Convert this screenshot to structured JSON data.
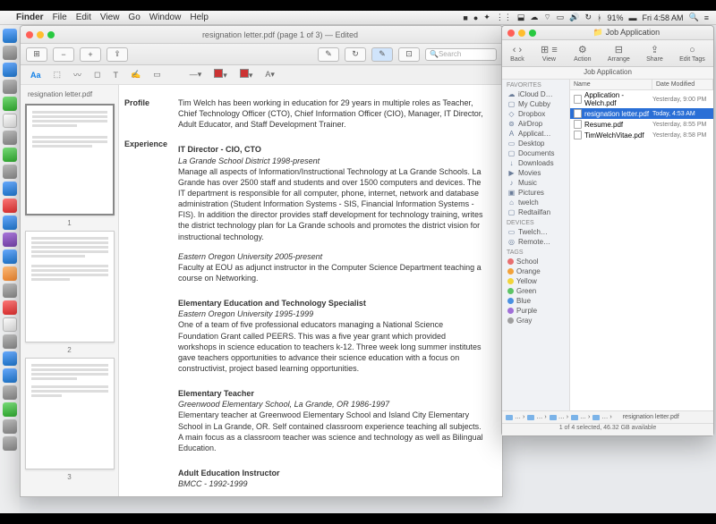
{
  "menubar": {
    "app": "Finder",
    "items": [
      "File",
      "Edit",
      "View",
      "Go",
      "Window",
      "Help"
    ],
    "battery": "91%",
    "clock": "Fri 4:58 AM"
  },
  "preview": {
    "title": "resignation letter.pdf (page 1 of 3) — Edited",
    "search_ph": "Search",
    "sidebar_title": "resignation letter.pdf",
    "markup": {
      "aa": "Aa"
    },
    "thumbs": [
      "1",
      "2",
      "3"
    ],
    "profile_label": "Profile",
    "experience_label": "Experience",
    "profile_text": "Tim Welch has been working in education for 29 years in multiple roles as Teacher, Chief Technology Officer (CTO), Chief Information Officer (CIO), Manager, IT Director, Adult Educator, and Staff Development Trainer.",
    "jobs": [
      {
        "title": "IT Director - CIO, CTO",
        "sub": "La Grande School District        1998-present",
        "desc": "Manage all aspects of Information/Instructional Technology at La Grande Schools. La Grande has over 2500 staff and students and over 1500 computers and devices. The IT department is responsible for all computer, phone, internet, network and database administration (Student Information Systems - SIS, Financial Information Systems - FIS). In addition the director provides staff development for technology training, writes the district technology plan for La Grande schools and promotes the district vision for instructional technology."
      },
      {
        "title": "",
        "sub": "Eastern Oregon University        2005-present",
        "desc": "Faculty at EOU as adjunct instructor in the Computer Science Department teaching a course on Networking."
      },
      {
        "title": "Elementary Education and Technology Specialist",
        "sub": "Eastern Oregon University        1995-1999",
        "desc": "One of a team of five professional educators managing a National Science Foundation Grant called PEERS. This was a five year grant which provided workshops in science education to teachers k-12. Three week long summer institutes gave teachers opportunities to advance their science education with a focus on constructivist, project based learning opportunities."
      },
      {
        "title": "Elementary Teacher",
        "sub": "Greenwood Elementary School, La Grande, OR    1986-1997",
        "desc": "Elementary teacher at Greenwood Elementary School and Island City Elementary School in La Grande, OR. Self contained classroom experience teaching all subjects. A main focus as a classroom teacher was science and technology as well as Bilingual Education."
      },
      {
        "title": "Adult Education Instructor",
        "sub": "BMCC - 1992-1999",
        "desc": ""
      }
    ]
  },
  "finder": {
    "title": "Job Application",
    "path": "Job Application",
    "toolbar": {
      "back": "Back",
      "view": "View",
      "action": "Action",
      "arrange": "Arrange",
      "share": "Share",
      "edit": "Edit Tags"
    },
    "cols": {
      "name": "Name",
      "date": "Date Modified"
    },
    "files": [
      {
        "name": "Application - Welch.pdf",
        "date": "Yesterday, 9:00 PM",
        "sel": false
      },
      {
        "name": "resignation letter.pdf",
        "date": "Today, 4:53 AM",
        "sel": true
      },
      {
        "name": "Resume.pdf",
        "date": "Yesterday, 8:55 PM",
        "sel": false
      },
      {
        "name": "TimWelchVitae.pdf",
        "date": "Yesterday, 8:58 PM",
        "sel": false
      }
    ],
    "favorites_h": "Favorites",
    "favorites": [
      {
        "icon": "☁",
        "label": "iCloud D…"
      },
      {
        "icon": "▢",
        "label": "My Cubby"
      },
      {
        "icon": "◇",
        "label": "Dropbox"
      },
      {
        "icon": "⊚",
        "label": "AirDrop"
      },
      {
        "icon": "A",
        "label": "Applicat…"
      },
      {
        "icon": "▭",
        "label": "Desktop"
      },
      {
        "icon": "▢",
        "label": "Documents"
      },
      {
        "icon": "↓",
        "label": "Downloads"
      },
      {
        "icon": "▶",
        "label": "Movies"
      },
      {
        "icon": "♪",
        "label": "Music"
      },
      {
        "icon": "▣",
        "label": "Pictures"
      },
      {
        "icon": "⌂",
        "label": "twelch"
      },
      {
        "icon": "▢",
        "label": "Redtailfan"
      }
    ],
    "devices_h": "Devices",
    "devices": [
      {
        "icon": "▭",
        "label": "Twelch…"
      },
      {
        "icon": "◎",
        "label": "Remote…"
      }
    ],
    "tags_h": "Tags",
    "tags": [
      {
        "color": "#e86f6f",
        "label": "School"
      },
      {
        "color": "#f2a23a",
        "label": "Orange"
      },
      {
        "color": "#f2d43a",
        "label": "Yellow"
      },
      {
        "color": "#5dc466",
        "label": "Green"
      },
      {
        "color": "#4a90e2",
        "label": "Blue"
      },
      {
        "color": "#a06fd8",
        "label": "Purple"
      },
      {
        "color": "#9e9e9e",
        "label": "Gray"
      }
    ],
    "pathbar": [
      "…",
      "…",
      "…",
      "…",
      "…",
      "resignation letter.pdf"
    ],
    "status": "1 of 4 selected, 46.32 GB available"
  }
}
